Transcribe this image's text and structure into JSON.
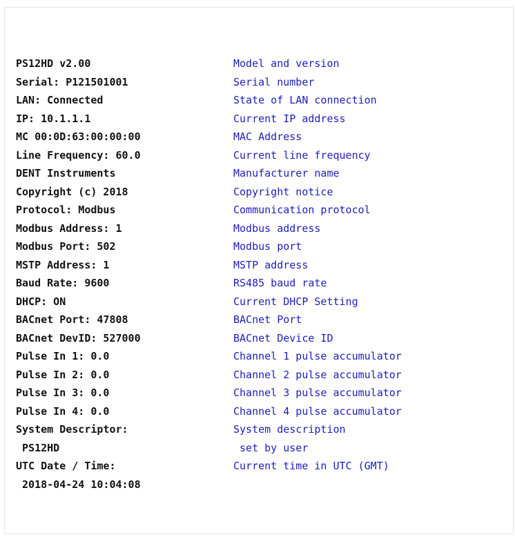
{
  "rows": [
    {
      "left": "PS12HD v2.00",
      "right": "Model and version"
    },
    {
      "left": "Serial: P121501001",
      "right": "Serial number"
    },
    {
      "left": "LAN: Connected",
      "right": "State of LAN connection"
    },
    {
      "left": "IP: 10.1.1.1",
      "right": "Current IP address"
    },
    {
      "left": "MC 00:0D:63:00:00:00",
      "right": "MAC Address"
    },
    {
      "left": "Line Frequency: 60.0",
      "right": "Current line frequency"
    },
    {
      "left": "DENT Instruments",
      "right": "Manufacturer name"
    },
    {
      "left": "Copyright (c) 2018",
      "right": "Copyright notice"
    },
    {
      "left": "Protocol: Modbus",
      "right": "Communication protocol"
    },
    {
      "left": "Modbus Address: 1",
      "right": "Modbus address"
    },
    {
      "left": "Modbus Port: 502",
      "right": "Modbus port"
    },
    {
      "left": "MSTP Address: 1",
      "right": "MSTP address"
    },
    {
      "left": "Baud Rate: 9600",
      "right": "RS485 baud rate"
    },
    {
      "left": "DHCP: ON",
      "right": "Current DHCP Setting"
    },
    {
      "left": "BACnet Port: 47808",
      "right": "BACnet Port"
    },
    {
      "left": "BACnet DevID: 527000",
      "right": "BACnet Device ID"
    },
    {
      "left": "Pulse In 1: 0.0",
      "right": "Channel 1 pulse accumulator"
    },
    {
      "left": "Pulse In 2: 0.0",
      "right": "Channel 2 pulse accumulator"
    },
    {
      "left": "Pulse In 3: 0.0",
      "right": "Channel 3 pulse accumulator"
    },
    {
      "left": "Pulse In 4: 0.0",
      "right": "Channel 4 pulse accumulator"
    },
    {
      "left": "System Descriptor:",
      "right": "System description"
    },
    {
      "left": " PS12HD",
      "right": " set by user"
    },
    {
      "left": "UTC Date / Time:",
      "right": "Current time in UTC (GMT)"
    },
    {
      "left": " 2018-04-24 10:04:08",
      "right": ""
    }
  ],
  "colors": {
    "label_text": "#111111",
    "description_text": "#1d1db8",
    "panel_border": "#e4e4e4",
    "background": "#ffffff"
  }
}
